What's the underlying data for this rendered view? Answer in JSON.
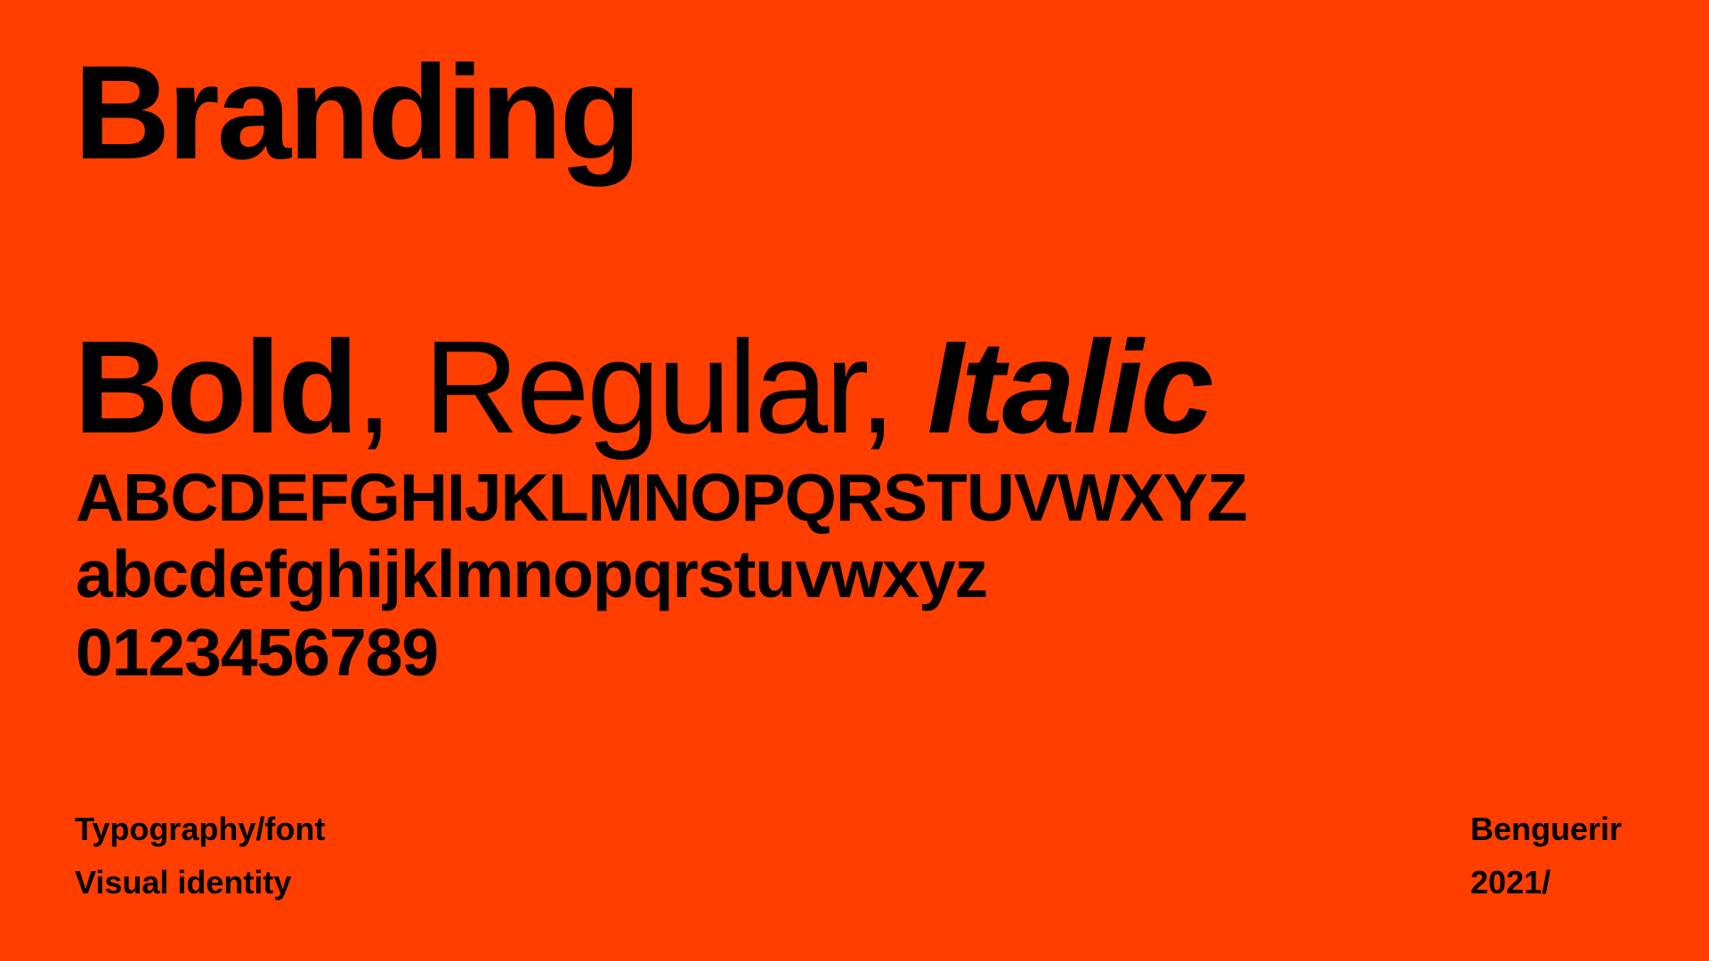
{
  "colors": {
    "background": "#ff3e00",
    "text": "#000000"
  },
  "header": {
    "title": "Branding"
  },
  "specimen": {
    "bold": "Bold",
    "separator_1": ", ",
    "regular": "Regular, ",
    "italic": "Italic",
    "uppercase": "ABCDEFGHIJKLMNOPQRSTUVWXYZ",
    "lowercase": "abcdefghijklmnopqrstuvwxyz",
    "digits": "0123456789"
  },
  "footer": {
    "left_line_1": "Typography/font",
    "left_line_2": "Visual identity",
    "right_line_1": "Benguerir",
    "right_line_2": "2021/"
  }
}
